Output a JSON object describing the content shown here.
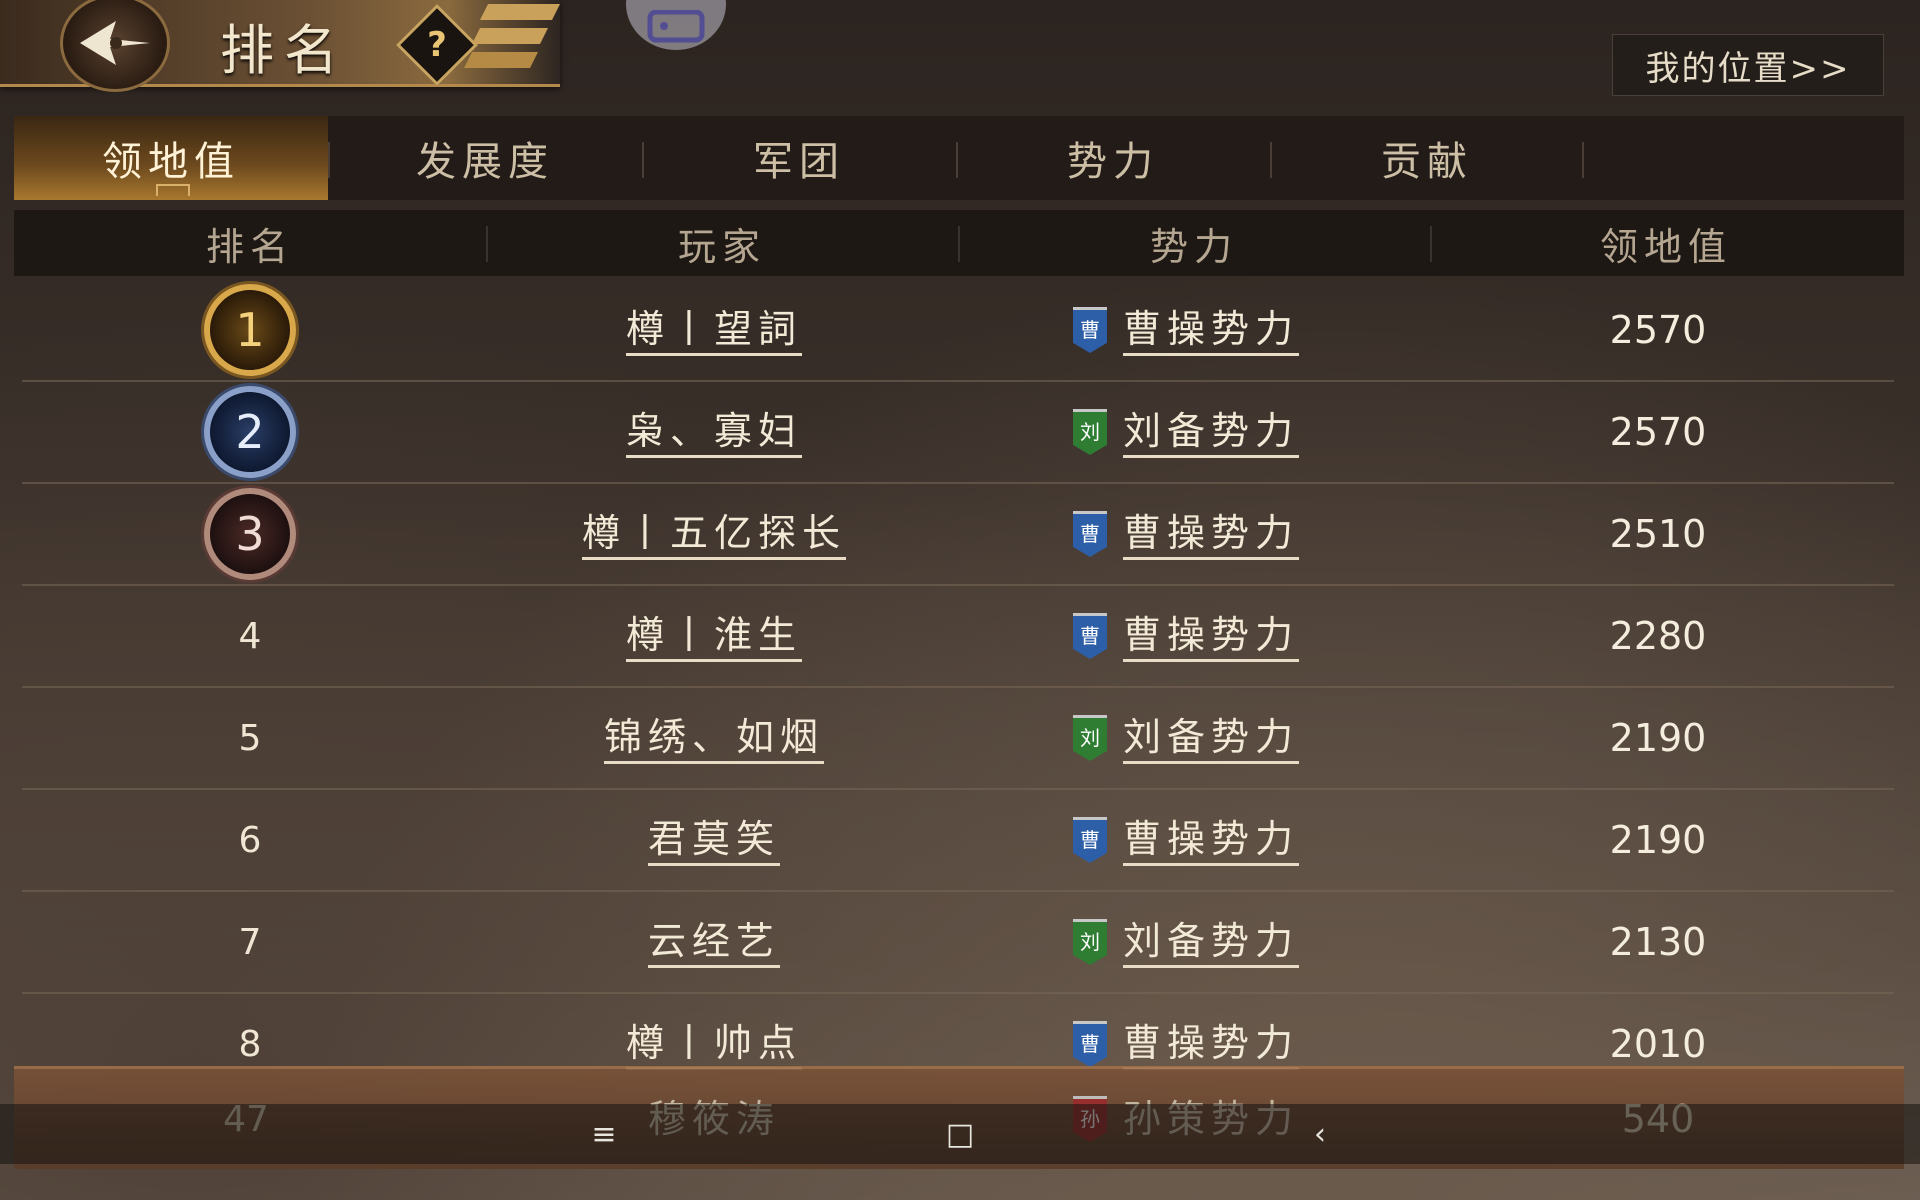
{
  "header": {
    "title": "排名",
    "help_label": "?",
    "my_position_label": "我的位置>>"
  },
  "tabs": [
    {
      "label": "领地值",
      "active": true
    },
    {
      "label": "发展度",
      "active": false
    },
    {
      "label": "军团",
      "active": false
    },
    {
      "label": "势力",
      "active": false
    },
    {
      "label": "贡献",
      "active": false
    }
  ],
  "table": {
    "columns": [
      "排名",
      "玩家",
      "势力",
      "领地值"
    ],
    "rows": [
      {
        "rank": "1",
        "player": "樽丨望詞",
        "faction": "曹操势力",
        "faction_badge": "曹",
        "value": "2570"
      },
      {
        "rank": "2",
        "player": "枭、寡妇",
        "faction": "刘备势力",
        "faction_badge": "刘",
        "value": "2570"
      },
      {
        "rank": "3",
        "player": "樽丨五亿探长",
        "faction": "曹操势力",
        "faction_badge": "曹",
        "value": "2510"
      },
      {
        "rank": "4",
        "player": "樽丨淮生",
        "faction": "曹操势力",
        "faction_badge": "曹",
        "value": "2280"
      },
      {
        "rank": "5",
        "player": "锦绣、如烟",
        "faction": "刘备势力",
        "faction_badge": "刘",
        "value": "2190"
      },
      {
        "rank": "6",
        "player": "君莫笑",
        "faction": "曹操势力",
        "faction_badge": "曹",
        "value": "2190"
      },
      {
        "rank": "7",
        "player": "云经艺",
        "faction": "刘备势力",
        "faction_badge": "刘",
        "value": "2130"
      },
      {
        "rank": "8",
        "player": "樽丨帅点",
        "faction": "曹操势力",
        "faction_badge": "曹",
        "value": "2010"
      }
    ],
    "my_row": {
      "rank": "47",
      "player": "穆筱涛",
      "faction": "孙策势力",
      "faction_badge": "孙",
      "value": "540"
    }
  },
  "colors": {
    "cao": "#2d5ea8",
    "liu": "#2e7d32",
    "sun": "#9c2a2a",
    "accent_gold": "#d8a84a"
  },
  "nav": {
    "menu_icon": "≡",
    "home_icon": "□",
    "back_icon": "‹"
  }
}
